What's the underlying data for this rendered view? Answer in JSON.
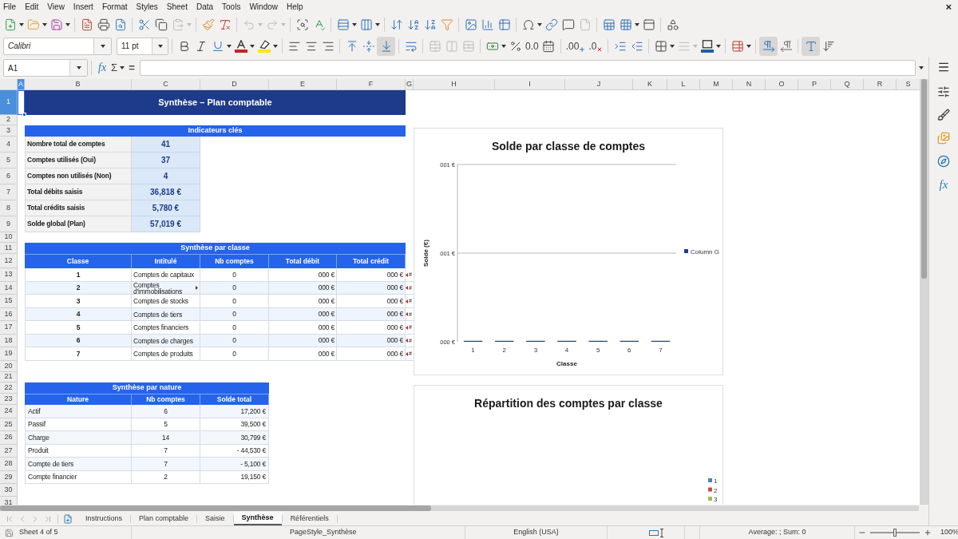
{
  "menu_bar": {
    "items": [
      "File",
      "Edit",
      "View",
      "Insert",
      "Format",
      "Styles",
      "Sheet",
      "Data",
      "Tools",
      "Window",
      "Help"
    ],
    "close": "×"
  },
  "standard_toolbar": {
    "paste_disabled": true,
    "undo_disabled": true,
    "redo_disabled": true,
    "header_footer_disabled": true
  },
  "formatting_toolbar": {
    "font_name": "Calibri",
    "font_size": "11 pt",
    "align_bottom_pressed": true,
    "merge_disabled": true,
    "standard_format": "0.0",
    "add_decimal": ".00",
    "delete_decimal": ".0",
    "border_style_disabled": true,
    "paragraph_left_to_right_pressed": true,
    "text_left_to_right_pressed": true
  },
  "formula_bar": {
    "name_box": "A1",
    "function_wizard": "fx",
    "sum": "Σ",
    "formula": "="
  },
  "sheet": {
    "columns": [
      {
        "label": "A",
        "selected": true
      },
      {
        "label": "B",
        "selected": false
      },
      {
        "label": "C",
        "selected": false
      },
      {
        "label": "D",
        "selected": false
      },
      {
        "label": "E",
        "selected": false
      },
      {
        "label": "F",
        "selected": false
      },
      {
        "label": "G",
        "selected": false
      },
      {
        "label": "H",
        "selected": false
      },
      {
        "label": "I",
        "selected": false
      },
      {
        "label": "J",
        "selected": false
      },
      {
        "label": "K",
        "selected": false
      },
      {
        "label": "L",
        "selected": false
      },
      {
        "label": "M",
        "selected": false
      },
      {
        "label": "N",
        "selected": false
      },
      {
        "label": "O",
        "selected": false
      },
      {
        "label": "P",
        "selected": false
      },
      {
        "label": "Q",
        "selected": false
      },
      {
        "label": "R",
        "selected": false
      },
      {
        "label": "S",
        "selected": false
      }
    ],
    "rows": [
      {
        "label": "1",
        "selected": true
      },
      {
        "label": "2",
        "selected": false
      },
      {
        "label": "3",
        "selected": false
      },
      {
        "label": "4",
        "selected": false
      },
      {
        "label": "5",
        "selected": false
      },
      {
        "label": "6",
        "selected": false
      },
      {
        "label": "7",
        "selected": false
      },
      {
        "label": "8",
        "selected": false
      },
      {
        "label": "9",
        "selected": false
      },
      {
        "label": "10",
        "selected": false
      },
      {
        "label": "11",
        "selected": false
      },
      {
        "label": "12",
        "selected": false
      },
      {
        "label": "13",
        "selected": false
      },
      {
        "label": "14",
        "selected": false
      },
      {
        "label": "15",
        "selected": false
      },
      {
        "label": "16",
        "selected": false
      },
      {
        "label": "17",
        "selected": false
      },
      {
        "label": "18",
        "selected": false
      },
      {
        "label": "19",
        "selected": false
      },
      {
        "label": "20",
        "selected": false
      },
      {
        "label": "21",
        "selected": false
      },
      {
        "label": "22",
        "selected": false
      },
      {
        "label": "23",
        "selected": false
      },
      {
        "label": "24",
        "selected": false
      },
      {
        "label": "25",
        "selected": false
      },
      {
        "label": "26",
        "selected": false
      },
      {
        "label": "27",
        "selected": false
      },
      {
        "label": "28",
        "selected": false
      },
      {
        "label": "29",
        "selected": false
      },
      {
        "label": "30",
        "selected": false
      },
      {
        "label": "31",
        "selected": false
      }
    ],
    "title": "Synthèse – Plan comptable",
    "indicators": {
      "title": "Indicateurs clés",
      "rows": [
        {
          "label": "Nombre total de comptes",
          "value": "41"
        },
        {
          "label": "Comptes utilisés (Oui)",
          "value": "37"
        },
        {
          "label": "Comptes non utilisés (Non)",
          "value": "4"
        },
        {
          "label": "Total débits saisis",
          "value": "36,818 €"
        },
        {
          "label": "Total crédits saisis",
          "value": "5,780 €"
        },
        {
          "label": "Solde global (Plan)",
          "value": "57,019 €"
        }
      ]
    },
    "class_summary": {
      "title": "Synthèse par classe",
      "columns": [
        "Classe",
        "Intitulé",
        "Nb comptes",
        "Total débit",
        "Total crédit"
      ],
      "rows": [
        {
          "cells": [
            "1",
            "Comptes de capitaux",
            "0",
            "000 €",
            "000 €"
          ],
          "label_clipped": false,
          "column_g": "#",
          "column_g_clipped": true
        },
        {
          "cells": [
            "2",
            "Comptes d'immobilisations",
            "0",
            "000 €",
            "000 €"
          ],
          "label_clipped": true,
          "column_g": "#",
          "column_g_clipped": true
        },
        {
          "cells": [
            "3",
            "Comptes de stocks",
            "0",
            "000 €",
            "000 €"
          ],
          "label_clipped": false,
          "column_g": "#",
          "column_g_clipped": true
        },
        {
          "cells": [
            "4",
            "Comptes de tiers",
            "0",
            "000 €",
            "000 €"
          ],
          "label_clipped": false,
          "column_g": "#",
          "column_g_clipped": true
        },
        {
          "cells": [
            "5",
            "Comptes financiers",
            "0",
            "000 €",
            "000 €"
          ],
          "label_clipped": false,
          "column_g": "#",
          "column_g_clipped": true
        },
        {
          "cells": [
            "6",
            "Comptes de charges",
            "0",
            "000 €",
            "000 €"
          ],
          "label_clipped": false,
          "column_g": "#",
          "column_g_clipped": true
        },
        {
          "cells": [
            "7",
            "Comptes de produits",
            "0",
            "000 €",
            "000 €"
          ],
          "label_clipped": false,
          "column_g": "#",
          "column_g_clipped": true
        }
      ]
    },
    "nature_summary": {
      "title": "Synthèse par nature",
      "columns": [
        "Nature",
        "Nb comptes",
        "Solde total"
      ],
      "rows": [
        [
          "Actif",
          "6",
          "17,200 €"
        ],
        [
          "Passif",
          "5",
          "39,500 €"
        ],
        [
          "Charge",
          "14",
          "30,799 €"
        ],
        [
          "Produit",
          "7",
          "- 44,530 €"
        ],
        [
          "Compte de tiers",
          "7",
          "- 5,100 €"
        ],
        [
          "Compte financier",
          "2",
          "19,150 €"
        ]
      ]
    },
    "charts": [
      {
        "kind": "readable",
        "chart_data": {
          "type": "bar",
          "title": "Solde par classe de comptes",
          "xlabel": "Classe",
          "ylabel": "Solde (€)",
          "categories": [
            "1",
            "2",
            "3",
            "4",
            "5",
            "6",
            "7"
          ],
          "series": [
            {
              "name": "Column G",
              "color": "#1f3c96",
              "values": [
                0,
                0,
                0,
                0,
                0,
                0,
                0
              ]
            }
          ],
          "ylim": [
            0,
            1
          ],
          "yticks": [
            {
              "value": 0,
              "label": "000 €"
            },
            {
              "value": 0.5,
              "label": "001 €"
            },
            {
              "value": 1,
              "label": "001 €"
            }
          ]
        }
      },
      {
        "kind": "legend_only",
        "title": "Répartition des comptes par classe",
        "legend": [
          {
            "label": "1",
            "color": "#4f81bd"
          },
          {
            "label": "2",
            "color": "#c0504d"
          },
          {
            "label": "3",
            "color": "#9bbb59"
          }
        ]
      }
    ]
  },
  "sidebar": {
    "functions": "fx"
  },
  "sheet_tabs": [
    {
      "label": "Instructions",
      "selected": false
    },
    {
      "label": "Plan comptable",
      "selected": false
    },
    {
      "label": "Saisie",
      "selected": false
    },
    {
      "label": "Synthèse",
      "selected": true
    },
    {
      "label": "Référentiels",
      "selected": false
    }
  ],
  "status_bar": {
    "sheet_position": "Sheet 4 of 5",
    "page_style": "PageStyle_Synthèse",
    "language": "English (USA)",
    "selection_summary": "Average: ; Sum: 0",
    "zoom": {
      "level": 0.5,
      "label": "100%"
    }
  }
}
